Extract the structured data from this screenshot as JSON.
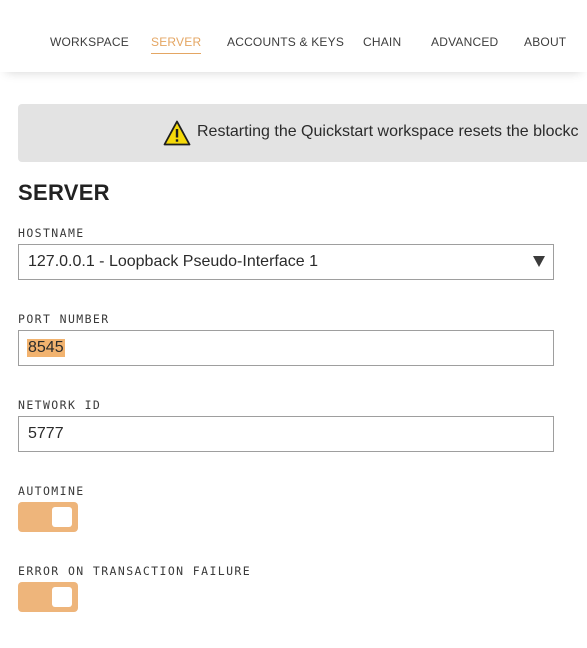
{
  "nav": {
    "tabs": [
      {
        "label": "WORKSPACE",
        "active": false
      },
      {
        "label": "SERVER",
        "active": true
      },
      {
        "label": "ACCOUNTS & KEYS",
        "active": false
      },
      {
        "label": "CHAIN",
        "active": false
      },
      {
        "label": "ADVANCED",
        "active": false
      },
      {
        "label": "ABOUT",
        "active": false
      }
    ],
    "accent_color": "#e4a663"
  },
  "banner": {
    "icon": "warning-icon",
    "text": "Restarting the Quickstart workspace resets the blockc"
  },
  "server": {
    "title": "SERVER",
    "hostname": {
      "label": "HOSTNAME",
      "value": "127.0.0.1 - Loopback Pseudo-Interface 1"
    },
    "port": {
      "label": "PORT NUMBER",
      "value": "8545"
    },
    "network_id": {
      "label": "NETWORK ID",
      "value": "5777"
    },
    "automine": {
      "label": "AUTOMINE",
      "on": true
    },
    "error_on_failure": {
      "label": "ERROR ON TRANSACTION FAILURE",
      "on": true
    },
    "toggle_color": "#eeb57b"
  }
}
